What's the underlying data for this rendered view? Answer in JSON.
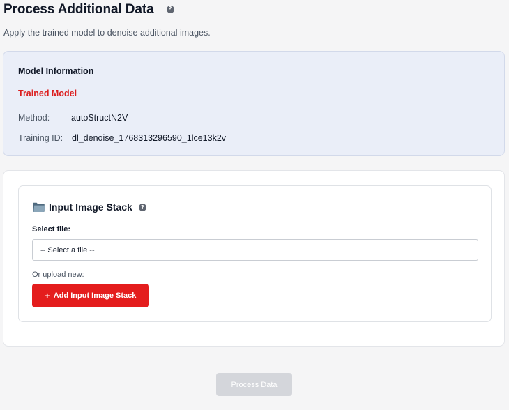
{
  "header": {
    "title": "Process Additional Data",
    "help_icon": "question-circle-icon",
    "subtitle": "Apply the trained model to denoise additional images."
  },
  "model_info": {
    "heading": "Model Information",
    "model_label": "Trained Model",
    "method_label": "Method:",
    "method_value": "autoStructN2V",
    "training_id_label": "Training ID:",
    "training_id_value": "dl_denoise_1768313296590_1lce13k2v"
  },
  "input_stack": {
    "icon": "folder-icon",
    "title": "Input Image Stack",
    "help_icon": "question-circle-icon",
    "select_label": "Select file:",
    "select_value": "-- Select a file --",
    "upload_label": "Or upload new:",
    "add_button_icon": "plus-icon",
    "add_button_label": "Add Input Image Stack"
  },
  "actions": {
    "process_label": "Process Data"
  },
  "colors": {
    "accent_red": "#e41d1d",
    "model_label_red": "#dc1e1e",
    "info_panel_bg": "#eaeef8",
    "disabled_button": "#d4d6db"
  }
}
